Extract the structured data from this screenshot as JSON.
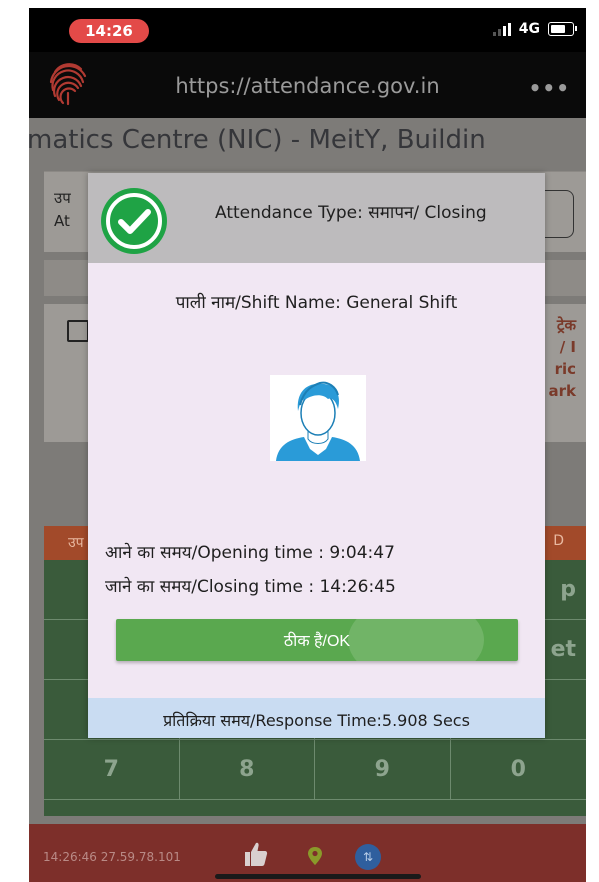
{
  "status_bar": {
    "time": "14:26",
    "network": "4G"
  },
  "browser": {
    "url": "https://attendance.gov.in"
  },
  "page": {
    "header": "matics Centre (NIC) - MeitY, Buildin"
  },
  "background_form": {
    "label_line1": "उप",
    "label_line2": "At",
    "hint_lines": [
      "ट्रेक",
      "/ I",
      "ric",
      "ark"
    ],
    "keypad_header_left": "उप",
    "keypad_header_right": "D",
    "keys": [
      "",
      "",
      "",
      "p",
      "",
      "",
      "",
      "et",
      "",
      "",
      "",
      "",
      "7",
      "8",
      "9",
      "0"
    ]
  },
  "dialog": {
    "title": "Attendance Type: समापन/ Closing",
    "shift_name": "पाली नाम/Shift Name: General Shift",
    "opening_time": "आने का समय/Opening time : 9:04:47",
    "closing_time": "जाने का समय/Closing time : 14:26:45",
    "ok_label": "ठीक है/OK",
    "response_time": "प्रतिक्रिया समय/Response Time:5.908 Secs"
  },
  "bottom_bar": {
    "info": "14:26:46  27.59.78.101"
  },
  "colors": {
    "ok_button": "#5aa84f",
    "check_green": "#1fa345",
    "time_pill": "#e34a48",
    "response_bar": "#c9dcf2",
    "avatar_blue": "#2a9bd8"
  }
}
